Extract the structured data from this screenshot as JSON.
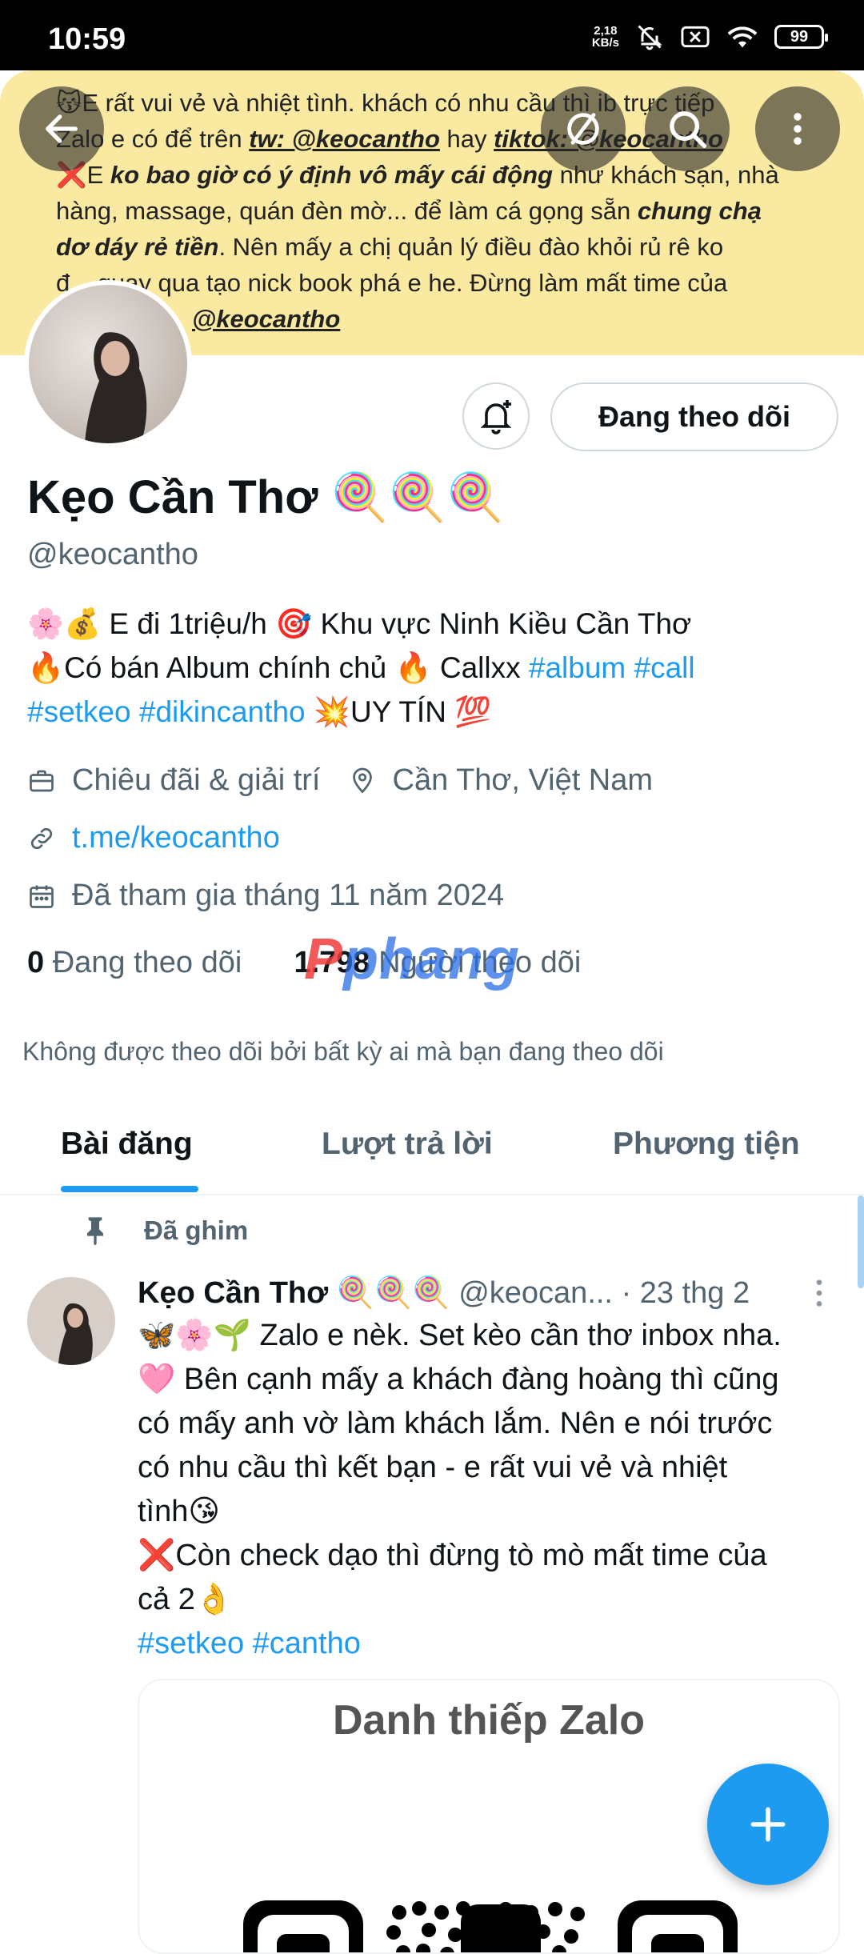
{
  "status_bar": {
    "time": "10:59",
    "speed_value": "2,18",
    "speed_unit": "KB/s",
    "battery": "99"
  },
  "banner": {
    "line1": "😽E rất vui vẻ và nhiệt tình. khách có nhu cầu thì ib trực tiếp",
    "line2_a": "Zalo e có để trên ",
    "line2_link1": "tw: @keocantho",
    "line2_b": " hay ",
    "line2_link2": "tiktok: @keocantho",
    "line3_a": "❌E ",
    "line3_bold": "ko bao giờ có ý định vô mấy cái động",
    "line3_b": " như khách sạn, nhà",
    "line4_a": "hàng, massage, quán đèn mờ... để làm cá gọng sẵn ",
    "line4_bold": "chung chạ",
    "line5_bold": "dơ dáy rẻ tiền",
    "line5_b": ". Nên mấy a chị quản lý điều đào khỏi rủ rê ko",
    "line6": "đ... quay qua tạo nick book phá e he. Đừng làm mất time của",
    "line7_link": "@keocantho"
  },
  "header_icons": [
    "back-arrow-icon",
    "hide-icon",
    "search-icon",
    "more-vertical-icon"
  ],
  "profile": {
    "name": "Kẹo Cần Thơ 🍭🍭🍭",
    "handle": "@keocantho",
    "follow_button": "Đang theo dõi",
    "bio_line1": "🌸💰 E đi 1triệu/h 🎯 Khu vực Ninh Kiều Cần Thơ",
    "bio_line2_a": "🔥Có bán Album chính chủ 🔥 Callxx ",
    "bio_tag1": "#album",
    "bio_tag2": "#call",
    "bio_tag3": "#setkeo",
    "bio_tag4": "#dikincantho",
    "bio_line3_b": " 💥UY TÍN 💯",
    "category": "Chiêu đãi & giải trí",
    "location": "Cần Thơ, Việt Nam",
    "website": "t.me/keocantho",
    "joined": "Đã tham gia tháng 11 năm 2024",
    "following_count": "0",
    "following_label": "Đang theo dõi",
    "followers_count": "1.798",
    "followers_label": "Người theo dõi",
    "not_followed_note": "Không được theo dõi bởi bất kỳ ai mà bạn đang theo dõi"
  },
  "watermark": {
    "part1": "P",
    "part2": "phang"
  },
  "tabs": [
    {
      "label": "Bài đăng",
      "active": true
    },
    {
      "label": "Lượt trả lời",
      "active": false
    },
    {
      "label": "Phương tiện",
      "active": false
    }
  ],
  "post": {
    "pinned_label": "Đã ghim",
    "author_name": "Kẹo Cần Thơ 🍭🍭🍭",
    "author_handle": "@keocan...",
    "date": "· 23 thg 2",
    "line1": "🦋🌸🌱 Zalo e nèk. Set kèo cần thơ inbox nha.",
    "line2": "🩷 Bên cạnh mấy a khách đàng hoàng thì cũng",
    "line3": "có mấy anh vờ làm khách lắm. Nên e nói trước",
    "line4": "có nhu cầu thì kết bạn - e rất vui vẻ và nhiệt",
    "line5": "tình😘",
    "line6": "❌Còn check dạo thì đừng tò mò mất time của",
    "line7": "cả 2👌",
    "tag1": "#setkeo",
    "tag2": "#cantho",
    "card_title": "Danh thiếp Zalo"
  },
  "colors": {
    "accent": "#1d9bf0",
    "banner_bg": "#f9e9a1",
    "secondary_text": "#536471"
  }
}
